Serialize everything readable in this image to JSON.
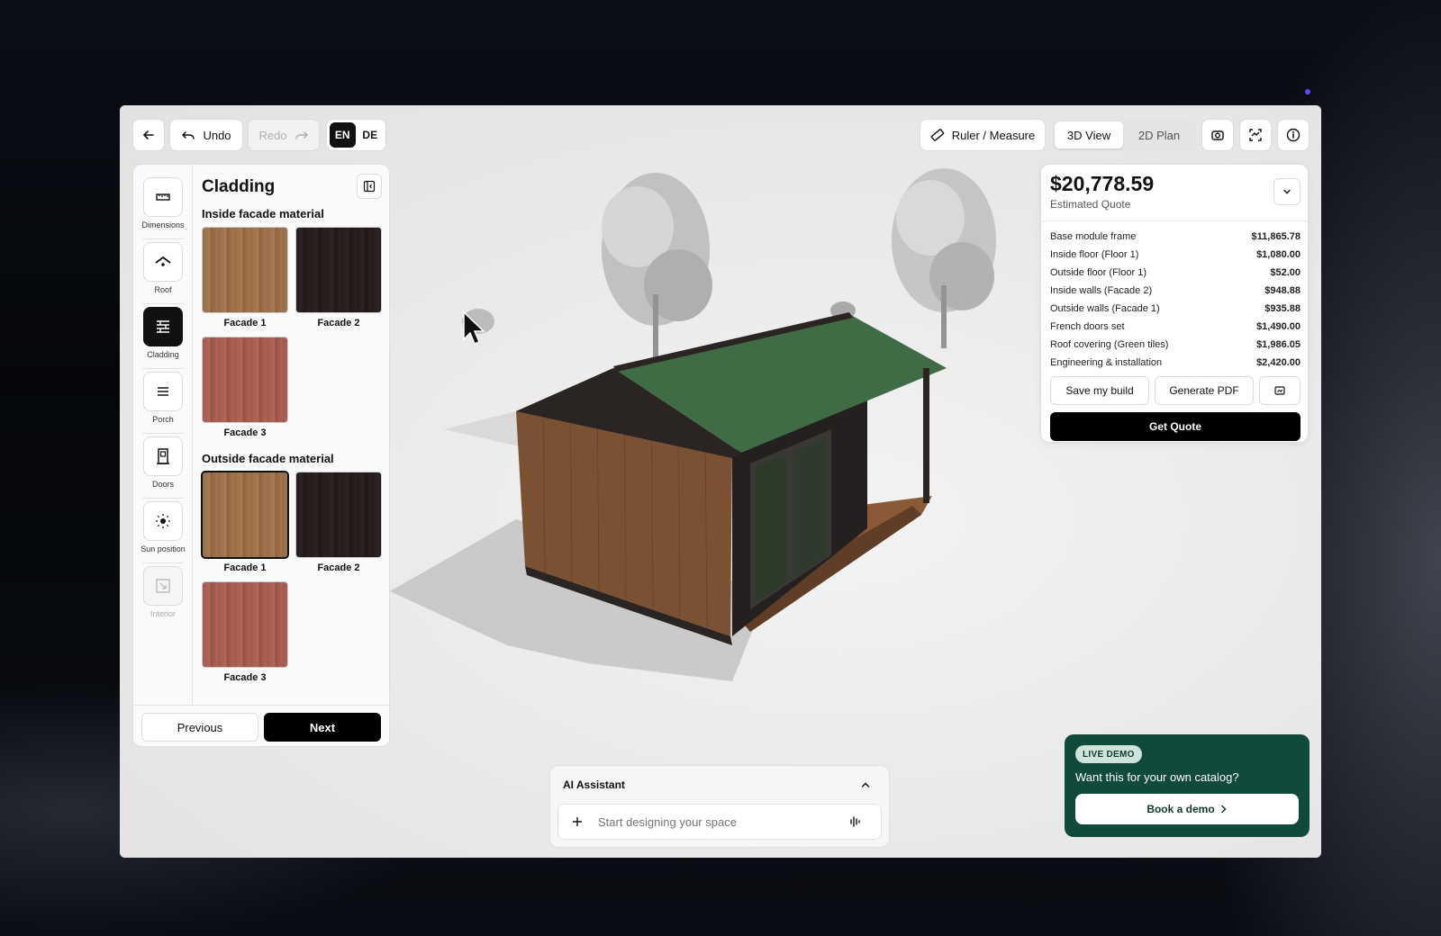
{
  "toolbar": {
    "undo_label": "Undo",
    "redo_label": "Redo",
    "languages": [
      "EN",
      "DE"
    ],
    "active_language": "EN",
    "ruler_label": "Ruler / Measure",
    "views": [
      "3D View",
      "2D Plan"
    ],
    "active_view": "3D View"
  },
  "sidebar": {
    "items": [
      {
        "label": "Dimensions",
        "icon": "ruler-icon"
      },
      {
        "label": "Roof",
        "icon": "roof-icon"
      },
      {
        "label": "Cladding",
        "icon": "cladding-icon",
        "active": true
      },
      {
        "label": "Porch",
        "icon": "porch-icon"
      },
      {
        "label": "Doors",
        "icon": "door-icon"
      },
      {
        "label": "Sun position",
        "icon": "sun-icon"
      },
      {
        "label": "Interior",
        "icon": "interior-icon",
        "disabled": true
      }
    ]
  },
  "panel": {
    "title": "Cladding",
    "inside_heading": "Inside facade material",
    "inside": [
      {
        "label": "Facade 1",
        "color": "#9c6f48"
      },
      {
        "label": "Facade 2",
        "color": "#271d1c"
      },
      {
        "label": "Facade 3",
        "color": "#a75b50"
      }
    ],
    "outside_heading": "Outside facade material",
    "outside": [
      {
        "label": "Facade 1",
        "color": "#9c6f48",
        "selected": true
      },
      {
        "label": "Facade 2",
        "color": "#271d1c"
      },
      {
        "label": "Facade 3",
        "color": "#a75b50"
      }
    ],
    "prev_label": "Previous",
    "next_label": "Next"
  },
  "quote": {
    "total": "$20,778.59",
    "subtitle": "Estimated Quote",
    "lines": [
      {
        "label": "Base module frame",
        "amount": "$11,865.78"
      },
      {
        "label": "Inside floor (Floor 1)",
        "amount": "$1,080.00"
      },
      {
        "label": "Outside floor (Floor 1)",
        "amount": "$52.00"
      },
      {
        "label": "Inside walls (Facade 2)",
        "amount": "$948.88"
      },
      {
        "label": "Outside walls (Facade 1)",
        "amount": "$935.88"
      },
      {
        "label": "French doors set",
        "amount": "$1,490.00"
      },
      {
        "label": "Roof covering (Green tiles)",
        "amount": "$1,986.05"
      },
      {
        "label": "Engineering & installation",
        "amount": "$2,420.00"
      }
    ],
    "save_label": "Save my build",
    "pdf_label": "Generate PDF",
    "get_label": "Get Quote"
  },
  "assistant": {
    "title": "AI Assistant",
    "placeholder": "Start designing your space"
  },
  "demo": {
    "badge": "LIVE DEMO",
    "text": "Want this for your own catalog?",
    "button": "Book a demo"
  },
  "colors": {
    "accent_dark": "#000000",
    "demo_green": "#0f4a3a",
    "roof_green": "#3f6b45"
  }
}
